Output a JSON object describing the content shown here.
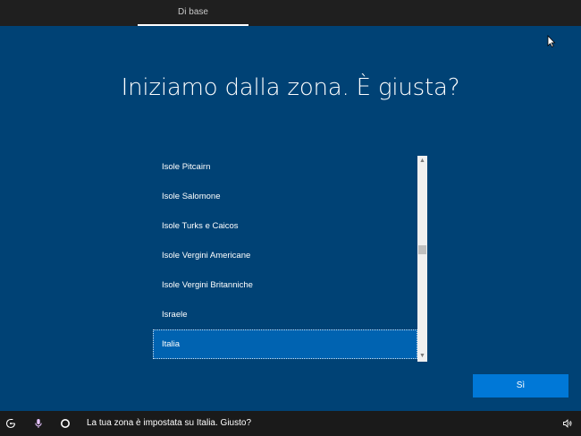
{
  "header": {
    "tab_label": "Di base"
  },
  "page_title": "Iniziamo dalla zona. È giusta?",
  "region_list": {
    "items": [
      {
        "label": "Isole Pitcairn",
        "selected": false
      },
      {
        "label": "Isole Salomone",
        "selected": false
      },
      {
        "label": "Isole Turks e Caicos",
        "selected": false
      },
      {
        "label": "Isole Vergini Americane",
        "selected": false
      },
      {
        "label": "Isole Vergini Britanniche",
        "selected": false
      },
      {
        "label": "Israele",
        "selected": false
      },
      {
        "label": "Italia",
        "selected": true
      }
    ]
  },
  "actions": {
    "yes_label": "Sì"
  },
  "footer": {
    "status_text": "La tua zona è impostata su Italia. Giusto?",
    "icons": [
      "accessibility-icon",
      "microphone-icon",
      "cortana-icon",
      "speaker-icon"
    ]
  },
  "colors": {
    "background": "#004275",
    "selected_item": "#0063b1",
    "accent_button": "#0078d7",
    "bar": "#1f1f1f"
  }
}
